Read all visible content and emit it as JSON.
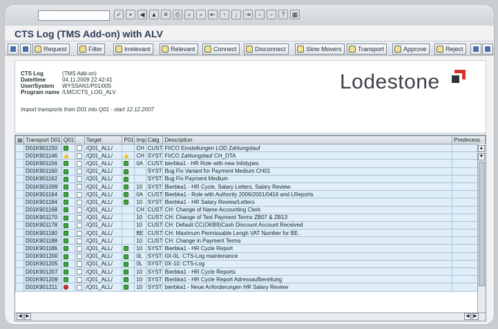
{
  "window": {
    "title": "CTS Log (TMS Add-on) with ALV"
  },
  "toolbar": {
    "buttons": [
      {
        "label": "Request",
        "icon": "request-icon"
      },
      {
        "label": "Filter",
        "icon": "filter-icon"
      },
      {
        "label": "Irrelevant",
        "icon": "irrelevant-icon"
      },
      {
        "label": "Relevant",
        "icon": "relevant-icon"
      },
      {
        "label": "Connect",
        "icon": "connect-icon"
      },
      {
        "label": "Disconnect",
        "icon": "disconnect-icon"
      },
      {
        "label": "Slow Movers",
        "icon": "slow-movers-icon"
      },
      {
        "label": "Transport",
        "icon": "transport-icon"
      },
      {
        "label": "Approve",
        "icon": "approve-icon"
      },
      {
        "label": "Reject",
        "icon": "reject-icon"
      }
    ]
  },
  "header": {
    "cts_log_label": "CTS Log",
    "cts_log_value": "(TMS Add-on)",
    "datetime_label": "Date/time",
    "datetime_value": "04.11.2009 22:42:41",
    "user_label": "User/System",
    "user_value": "WYSSAN1/P01/005",
    "program_label": "Program name",
    "program_value": "/LMC/CTS_LOG_ALV",
    "note": "Import transports from D01 into Q01 - start 12.12.2007",
    "logo_text": "Lodestone",
    "grip": "....."
  },
  "table": {
    "columns": [
      "Transport D01",
      "Q01",
      "",
      "Target",
      "P01",
      "Imp",
      "Catg",
      "Description",
      "Predecess"
    ],
    "rows": [
      {
        "tr": "D01K901150",
        "status": "ok",
        "target": "/Q01_ALL/",
        "p01": "",
        "imp": "CH",
        "catg": "CUST",
        "desc": "FI/CO Einstellungen LOD Zahlungslauf"
      },
      {
        "tr": "D01K901146",
        "status": "warn",
        "target": "/Q01_ALL/",
        "p01": "warn",
        "imp": "CH",
        "catg": "SYST",
        "desc": "FI/CO Zahlungslauf CH_DTA"
      },
      {
        "tr": "D01K901156",
        "status": "ok",
        "target": "/Q01_ALL/",
        "p01": "ok",
        "imp": "0A",
        "catg": "CUST",
        "desc": "bierbka1 - HR Role with new Infotypes"
      },
      {
        "tr": "D01K901160",
        "status": "ok",
        "target": "/Q01_ALL/",
        "p01": "ok",
        "imp": "",
        "catg": "SYST",
        "desc": "Bug Fix Variant for Payment Medium CH01"
      },
      {
        "tr": "D01K901162",
        "status": "ok",
        "target": "/Q01_ALL/",
        "p01": "ok",
        "imp": "",
        "catg": "SYST",
        "desc": "Bug Fix Payment Medium"
      },
      {
        "tr": "D01K901099",
        "status": "ok",
        "target": "/Q01_ALL/",
        "p01": "ok",
        "imp": "10",
        "catg": "SYST",
        "desc": "Bierbka1 - HR Cycle, Salary Letters, Salary Review"
      },
      {
        "tr": "D01K901164",
        "status": "ok",
        "target": "/Q01_ALL/",
        "p01": "ok",
        "imp": "0A",
        "catg": "CUST",
        "desc": "Bierbka1 - Role with Authority 2006/2001/0416 and LReports"
      },
      {
        "tr": "D01K901184",
        "status": "ok",
        "target": "/Q01_ALL/",
        "p01": "ok",
        "imp": "10",
        "catg": "SYST",
        "desc": "Bierbka1 - HR Salary Review/Letters"
      },
      {
        "tr": "D01K901168",
        "status": "ok",
        "target": "/Q01_ALL/",
        "p01": "",
        "imp": "CH",
        "catg": "CUST",
        "desc": "CH: Change of Name Accounting Clerk"
      },
      {
        "tr": "D01K901170",
        "status": "ok",
        "target": "/Q01_ALL/",
        "p01": "",
        "imp": "10",
        "catg": "CUST",
        "desc": "CH: Change of Text Payment Terms ZB07 & ZB13"
      },
      {
        "tr": "D01K901178",
        "status": "ok",
        "target": "/Q01_ALL/",
        "p01": "",
        "imp": "10",
        "catg": "CUST",
        "desc": "CH: Default CC(OKB9)Cash Discount Account Received"
      },
      {
        "tr": "D01K901180",
        "status": "ok",
        "target": "/Q01_ALL/",
        "p01": "",
        "imp": "BE",
        "catg": "CUST",
        "desc": "CH: Maximum Permissable Lengh VAT Number for BE."
      },
      {
        "tr": "D01K901188",
        "status": "ok",
        "target": "/Q01_ALL/",
        "p01": "",
        "imp": "10",
        "catg": "CUST",
        "desc": "CH: Change in Payment Terms"
      },
      {
        "tr": "D01K901186",
        "status": "ok",
        "target": "/Q01_ALL/",
        "p01": "ok",
        "imp": "10",
        "catg": "SYST",
        "desc": "Bierbka1 - HR Cycle Report"
      },
      {
        "tr": "D01K901200",
        "status": "ok",
        "target": "/Q01_ALL/",
        "p01": "ok",
        "imp": "0L",
        "catg": "SYST",
        "desc": "0X-0L: CTS-Log maintenance"
      },
      {
        "tr": "D01K901205",
        "status": "ok",
        "target": "/Q01_ALL/",
        "p01": "ok",
        "imp": "0L",
        "catg": "SYST",
        "desc": "0X-10: CTS-Log"
      },
      {
        "tr": "D01K901207",
        "status": "ok",
        "target": "/Q01_ALL/",
        "p01": "ok",
        "imp": "10",
        "catg": "SYST",
        "desc": "Bierbka1 - HR Cycle Reports"
      },
      {
        "tr": "D01K901209",
        "status": "ok",
        "target": "/Q01_ALL/",
        "p01": "ok",
        "imp": "10",
        "catg": "SYST",
        "desc": "Bierbka1 - HR Cycle Report Adressaufbereitung"
      },
      {
        "tr": "D01K901211",
        "status": "err",
        "target": "/Q01_ALL/",
        "p01": "ok",
        "imp": "10",
        "catg": "SYST",
        "desc": "bierbka1 - Neue Anforderungen HR Salary Review"
      }
    ]
  },
  "colors": {
    "ok": "#3fa63f",
    "warn": "#f0c020",
    "err": "#d8332a",
    "row": "#dfeef8"
  }
}
